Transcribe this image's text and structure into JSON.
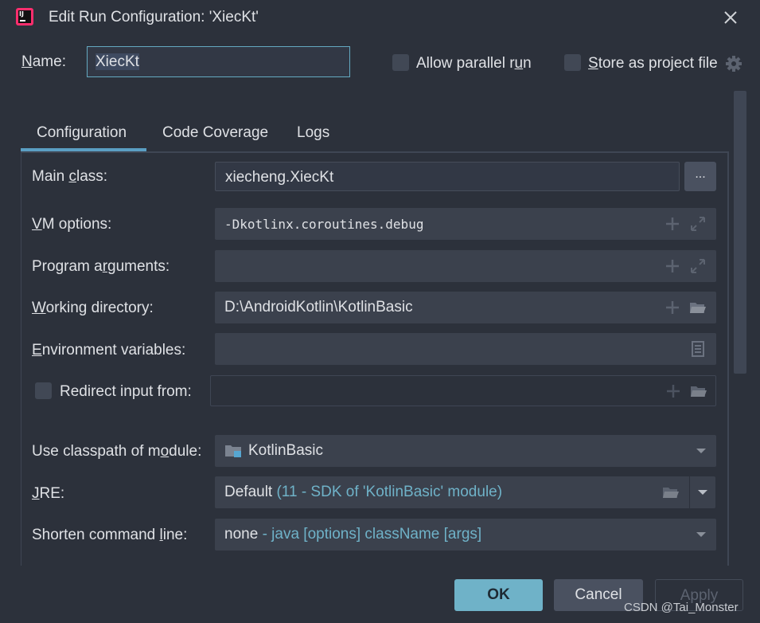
{
  "window": {
    "title": "Edit Run Configuration: 'XiecKt'"
  },
  "header": {
    "name_label": "Name:",
    "name_value": "XiecKt",
    "allow_parallel_label": "Allow parallel run",
    "allow_parallel_checked": false,
    "store_project_label": "Store as project file",
    "store_project_checked": false
  },
  "tabs": [
    {
      "label": "Configuration",
      "active": true
    },
    {
      "label": "Code Coverage",
      "active": false
    },
    {
      "label": "Logs",
      "active": false
    }
  ],
  "form": {
    "main_class_label": "Main class:",
    "main_class_value": "xiecheng.XiecKt",
    "browse_label": "...",
    "vm_options_label": "VM options:",
    "vm_options_value": "-Dkotlinx.coroutines.debug",
    "program_args_label": "Program arguments:",
    "program_args_value": "",
    "working_dir_label": "Working directory:",
    "working_dir_value": "D:\\AndroidKotlin\\KotlinBasic",
    "env_vars_label": "Environment variables:",
    "env_vars_value": "",
    "redirect_label": "Redirect input from:",
    "redirect_checked": false,
    "redirect_value": "",
    "classpath_label": "Use classpath of module:",
    "classpath_value": "KotlinBasic",
    "jre_label": "JRE:",
    "jre_value": "Default",
    "jre_detail": "(11 - SDK of 'KotlinBasic' module)",
    "shorten_label": "Shorten command line:",
    "shorten_value": "none",
    "shorten_detail": "- java [options] className [args]"
  },
  "footer": {
    "ok_label": "OK",
    "cancel_label": "Cancel",
    "apply_label": "Apply"
  },
  "watermark": "CSDN @Tai_Monster",
  "colors": {
    "background": "#2c313b",
    "field": "#3b414d",
    "accent": "#5a9ec3",
    "ok_button": "#6fb2c8",
    "hint_text": "#6fb2c8"
  }
}
